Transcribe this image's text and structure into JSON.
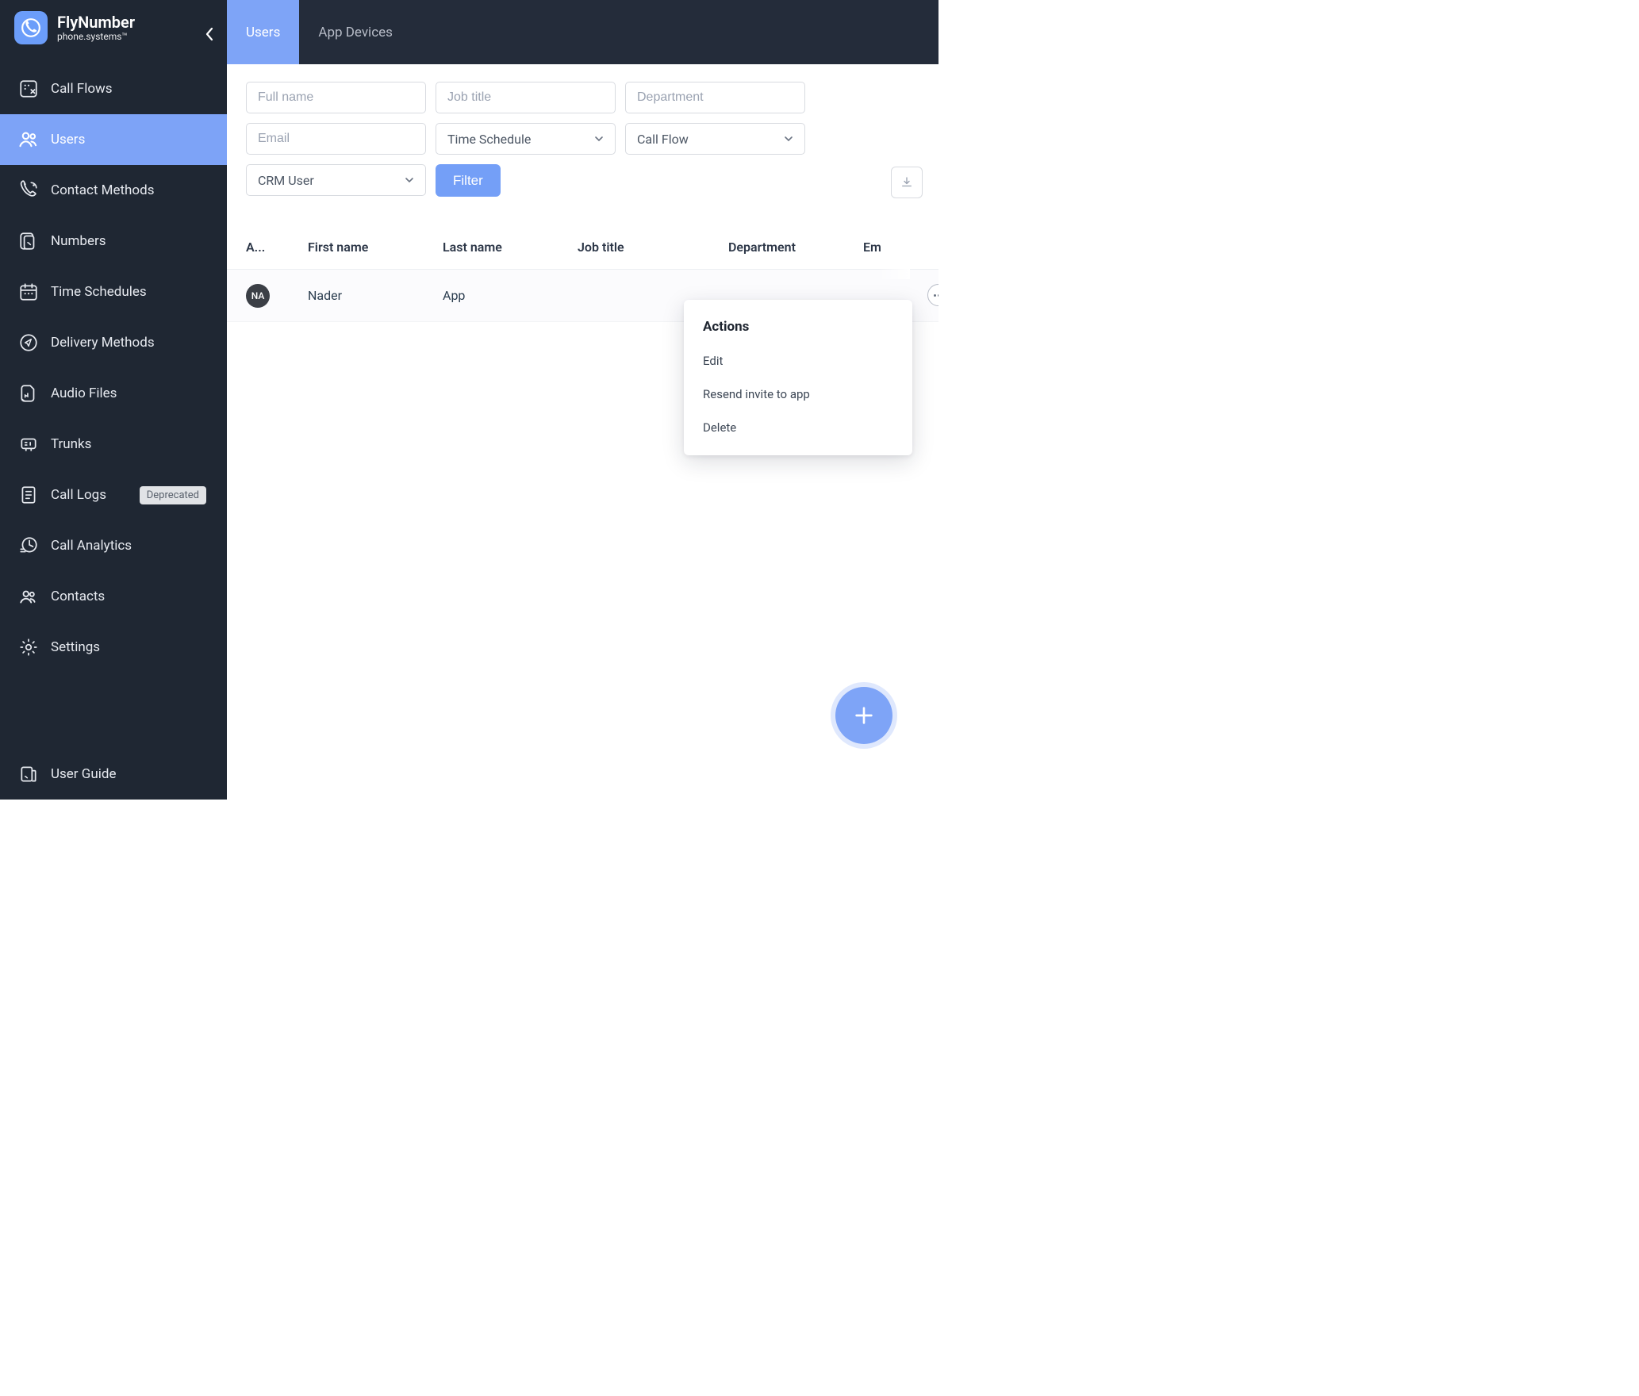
{
  "brand": {
    "title": "FlyNumber",
    "subtitle": "phone.systems™"
  },
  "sidebar": {
    "items": [
      {
        "label": "Call Flows"
      },
      {
        "label": "Users"
      },
      {
        "label": "Contact Methods"
      },
      {
        "label": "Numbers"
      },
      {
        "label": "Time Schedules"
      },
      {
        "label": "Delivery Methods"
      },
      {
        "label": "Audio Files"
      },
      {
        "label": "Trunks"
      },
      {
        "label": "Call Logs",
        "badge": "Deprecated"
      },
      {
        "label": "Call Analytics"
      },
      {
        "label": "Contacts"
      },
      {
        "label": "Settings"
      }
    ],
    "footer": {
      "label": "User Guide"
    }
  },
  "tabs": [
    {
      "label": "Users",
      "active": true
    },
    {
      "label": "App Devices",
      "active": false
    }
  ],
  "filters": {
    "full_name_ph": "Full name",
    "job_title_ph": "Job title",
    "department_ph": "Department",
    "email_ph": "Email",
    "time_schedule_label": "Time Schedule",
    "call_flow_label": "Call Flow",
    "crm_user_label": "CRM User",
    "filter_btn": "Filter"
  },
  "table": {
    "headers": {
      "avatar": "A...",
      "first_name": "First name",
      "last_name": "Last name",
      "job_title": "Job title",
      "department": "Department",
      "email": "Em"
    },
    "rows": [
      {
        "avatar_initials": "NA",
        "first_name": "Nader",
        "last_name": "App",
        "job_title": "",
        "department": "",
        "email": ""
      }
    ]
  },
  "popover": {
    "title": "Actions",
    "items": [
      {
        "label": "Edit"
      },
      {
        "label": "Resend invite to app"
      },
      {
        "label": "Delete"
      }
    ]
  }
}
